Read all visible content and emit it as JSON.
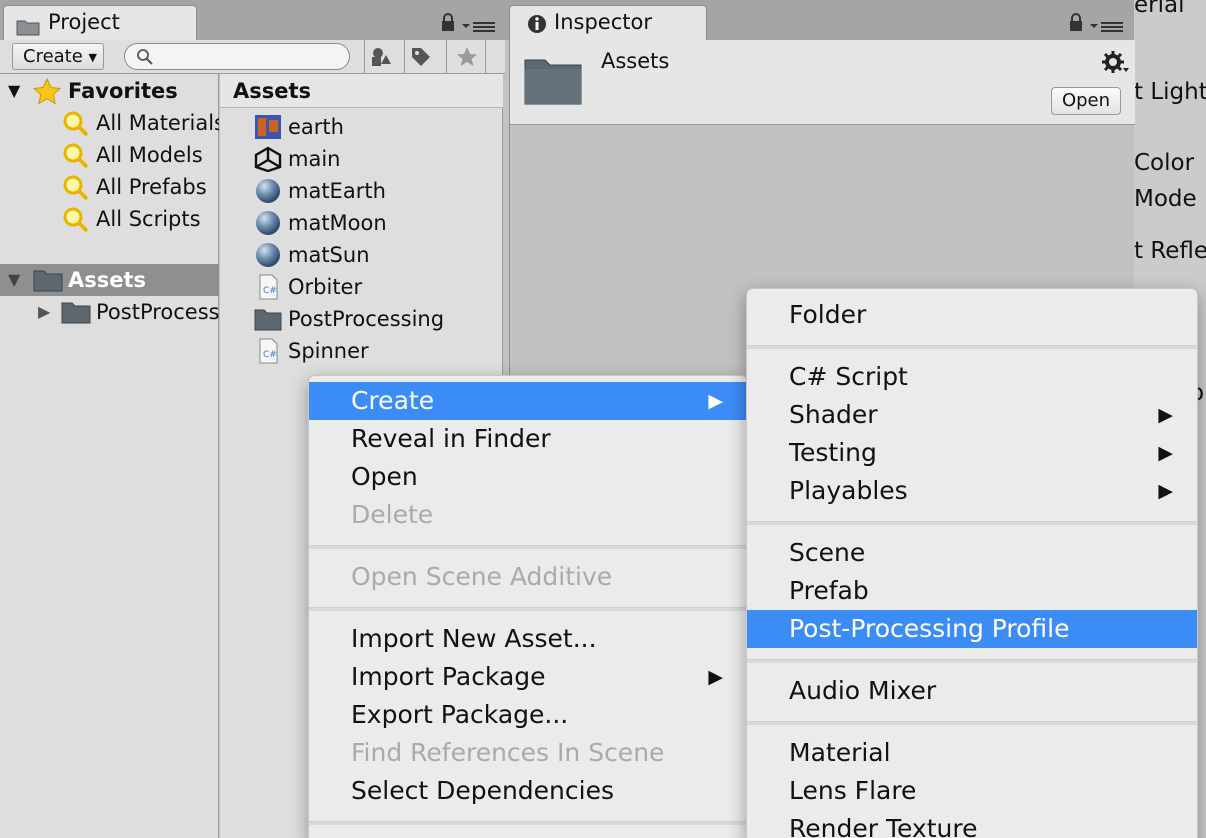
{
  "background_right": {
    "fragments": [
      "erial",
      "t Lighti",
      "Color",
      "Mode",
      "t Reflec",
      "ol"
    ]
  },
  "project_tab": {
    "title": "Project",
    "icon": "folder-icon"
  },
  "inspector_tab": {
    "title": "Inspector",
    "icon": "info-icon"
  },
  "project_toolbar": {
    "create_label": "Create",
    "search_placeholder": "",
    "icons": [
      "filter-by-type-icon",
      "filter-by-label-icon",
      "favorites-star-icon"
    ]
  },
  "favorites": {
    "label": "Favorites",
    "items": [
      {
        "label": "All Materials"
      },
      {
        "label": "All Models"
      },
      {
        "label": "All Prefabs"
      },
      {
        "label": "All Scripts"
      }
    ]
  },
  "tree": {
    "assets_label": "Assets",
    "children": [
      {
        "label": "PostProcessing"
      }
    ]
  },
  "assets_panel": {
    "header": "Assets",
    "items": [
      {
        "label": "earth",
        "icon": "texture-icon"
      },
      {
        "label": "main",
        "icon": "unity-scene-icon"
      },
      {
        "label": "matEarth",
        "icon": "material-sphere-icon"
      },
      {
        "label": "matMoon",
        "icon": "material-sphere-icon"
      },
      {
        "label": "matSun",
        "icon": "material-sphere-icon"
      },
      {
        "label": "Orbiter",
        "icon": "csharp-script-icon"
      },
      {
        "label": "PostProcessing",
        "icon": "folder-icon"
      },
      {
        "label": "Spinner",
        "icon": "csharp-script-icon"
      }
    ]
  },
  "inspector": {
    "title": "Assets",
    "open_label": "Open",
    "icon": "folder-icon"
  },
  "context_menu": {
    "items": [
      {
        "label": "Create",
        "submenu": true,
        "highlighted": true
      },
      {
        "label": "Reveal in Finder"
      },
      {
        "label": "Open"
      },
      {
        "label": "Delete",
        "disabled": true
      },
      {
        "separator": true
      },
      {
        "label": "Open Scene Additive",
        "disabled": true
      },
      {
        "separator": true
      },
      {
        "label": "Import New Asset..."
      },
      {
        "label": "Import Package",
        "submenu": true
      },
      {
        "label": "Export Package..."
      },
      {
        "label": "Find References In Scene",
        "disabled": true
      },
      {
        "label": "Select Dependencies"
      }
    ]
  },
  "create_submenu": {
    "items": [
      {
        "label": "Folder"
      },
      {
        "separator": true
      },
      {
        "label": "C# Script"
      },
      {
        "label": "Shader",
        "submenu": true
      },
      {
        "label": "Testing",
        "submenu": true
      },
      {
        "label": "Playables",
        "submenu": true
      },
      {
        "separator": true
      },
      {
        "label": "Scene"
      },
      {
        "label": "Prefab"
      },
      {
        "label": "Post-Processing Profile",
        "highlighted": true
      },
      {
        "separator": true
      },
      {
        "label": "Audio Mixer"
      },
      {
        "separator": true
      },
      {
        "label": "Material"
      },
      {
        "label": "Lens Flare"
      },
      {
        "label": "Render Texture"
      }
    ]
  },
  "colors": {
    "highlight": "#3c8cf5",
    "panel": "#dedede",
    "selection": "#8f8f8f",
    "favorite_star": "#f5c518"
  }
}
